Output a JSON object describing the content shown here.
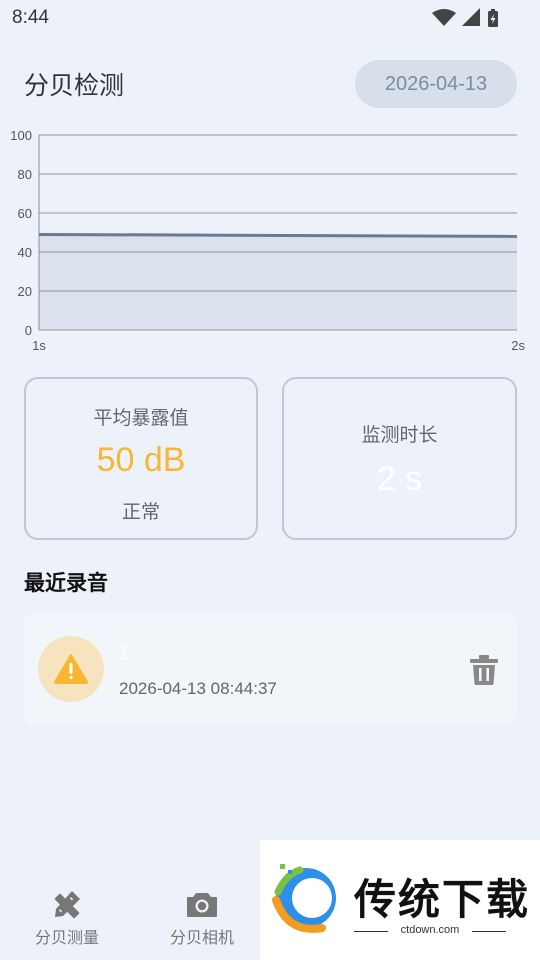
{
  "status_bar": {
    "time": "8:44",
    "icons": [
      "wifi-icon",
      "signal-icon",
      "battery-charging-icon"
    ]
  },
  "header": {
    "title": "分贝检测",
    "date": "2026-04-13"
  },
  "chart_data": {
    "type": "area",
    "x": [
      "1s",
      "2s"
    ],
    "series": [
      {
        "values": [
          49,
          48
        ]
      }
    ],
    "y_ticks": [
      "100",
      "80",
      "60",
      "40",
      "20",
      "0"
    ],
    "ylim": [
      0,
      100
    ],
    "grid": true,
    "line_color": "#6b7a93",
    "fill_color": "#dbe2ee"
  },
  "cards": {
    "average": {
      "label": "平均暴露值",
      "value": "50 dB",
      "status": "正常",
      "value_color": "#f7b733"
    },
    "duration": {
      "label": "监测时长",
      "value": "2 s"
    }
  },
  "recent": {
    "title": "最近录音",
    "items": [
      {
        "name": "1",
        "timestamp": "2026-04-13 08:44:37",
        "icon": "warning-icon",
        "action_icon": "trash-icon"
      }
    ]
  },
  "bottom_nav": {
    "items": [
      {
        "label": "分贝测量",
        "icon": "pencil-ruler-icon"
      },
      {
        "label": "分贝相机",
        "icon": "camera-icon"
      }
    ]
  },
  "watermark": {
    "text": "传统下载",
    "url": "ctdown.com"
  }
}
